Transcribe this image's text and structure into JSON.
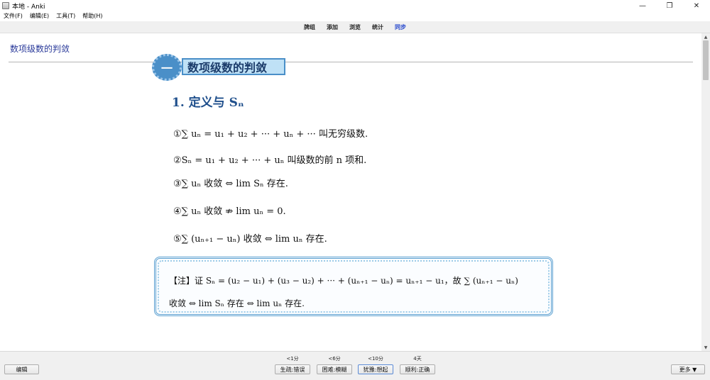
{
  "window": {
    "title": "本地 - Anki",
    "controls": [
      "—",
      "❐",
      "✕"
    ]
  },
  "menu": [
    "文件(F)",
    "编辑(E)",
    "工具(T)",
    "帮助(H)"
  ],
  "toolbar": [
    "牌组",
    "添加",
    "浏览",
    "统计",
    "同步"
  ],
  "card": {
    "header": "数项级数的判敛",
    "image": {
      "section_num": "一",
      "section_title": "数项级数的判敛",
      "subtitle": "1. 定义与 Sₙ",
      "formulas": [
        "①∑ uₙ = u₁ + u₂ + ··· + uₙ + ··· 叫无穷级数.",
        "②Sₙ = u₁ + u₂ + ··· + uₙ 叫级数的前 n 项和.",
        "③∑ uₙ 收敛 ⇔ lim Sₙ 存在.",
        "④∑ uₙ 收敛 ⇏ lim uₙ = 0.",
        "⑤∑ (uₙ₊₁ − uₙ) 收敛 ⇔ lim uₙ 存在."
      ],
      "note_lines": [
        "【注】证  Sₙ = (u₂ − u₁) + (u₃ − u₂) + ··· + (uₙ₊₁ − uₙ) = uₙ₊₁ − u₁，故 ∑ (uₙ₊₁ − uₙ)",
        "收敛 ⇔ lim Sₙ 存在 ⇔ lim uₙ 存在."
      ]
    }
  },
  "bottom": {
    "edit_label": "编辑",
    "more_label": "更多 ▼",
    "answers": [
      {
        "interval": "<1分",
        "label": "生疏:错误"
      },
      {
        "interval": "<6分",
        "label": "困难:模糊"
      },
      {
        "interval": "<10分",
        "label": "犹豫:想起"
      },
      {
        "interval": "4天",
        "label": "顺利:正确"
      }
    ]
  },
  "colors": {
    "sync_link": "#2244cc",
    "card_header": "#2a3a9a",
    "section_blue": "#4a8fc8"
  }
}
